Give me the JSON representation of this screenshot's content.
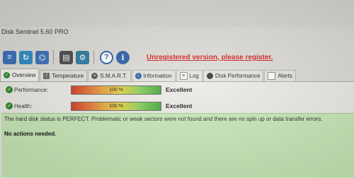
{
  "window": {
    "title": "Disk Sentinel 5.60 PRO"
  },
  "toolbar": {
    "buttons": [
      {
        "name": "disk-list-icon",
        "color": "#3a6fb8"
      },
      {
        "name": "refresh-icon",
        "color": "#2f8bc4"
      },
      {
        "name": "network-icon",
        "color": "#3a6fb8"
      },
      {
        "name": "report-icon",
        "color": "#4a4a4a"
      },
      {
        "name": "settings-icon",
        "color": "#2b7a9e"
      },
      {
        "name": "help-icon",
        "color": "#2b5fa8"
      },
      {
        "name": "info-icon",
        "color": "#2b5fa8"
      }
    ],
    "registration_notice": "Unregistered version, please register.",
    "notice_color": "#d41e1e"
  },
  "tabs": [
    {
      "label": "Overview",
      "active": true
    },
    {
      "label": "Temperature"
    },
    {
      "label": "S.M.A.R.T."
    },
    {
      "label": "Information"
    },
    {
      "label": "Log"
    },
    {
      "label": "Disk Performance"
    },
    {
      "label": "Alerts"
    }
  ],
  "metrics": {
    "performance": {
      "label": "Performance:",
      "percent_text": "100 %",
      "value": 1.0,
      "rating": "Excellent"
    },
    "health": {
      "label": "Health:",
      "percent_text": "100 %",
      "value": 1.0,
      "rating": "Excellent"
    }
  },
  "status": {
    "message": "The hard disk status is PERFECT. Problematic or weak sectors were not found and there are no spin up or data transfer errors.",
    "actions": "No actions needed.",
    "background_color": "#c9e9b9"
  }
}
